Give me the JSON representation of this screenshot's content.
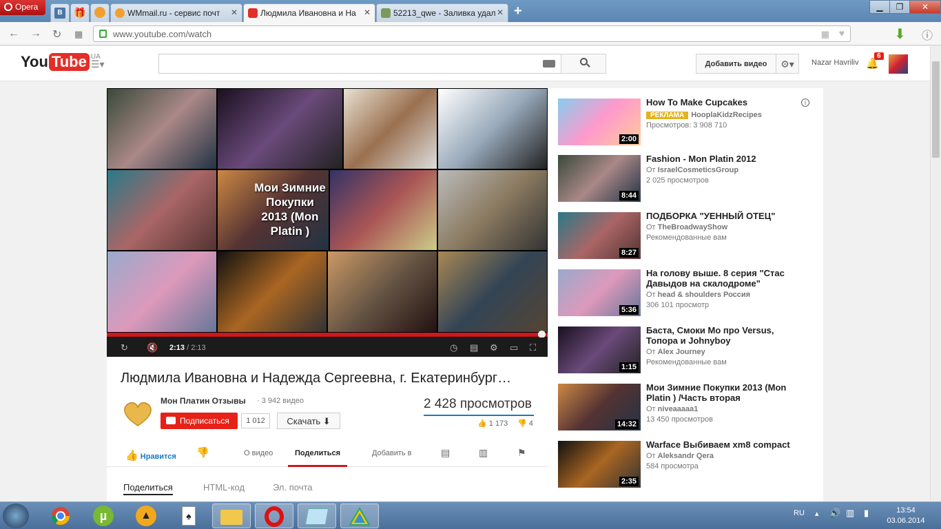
{
  "browser": {
    "app_name": "Opera",
    "tabs": [
      {
        "label": "WMmail.ru - сервис почт"
      },
      {
        "label": "Людмила Ивановна и На"
      },
      {
        "label": "52213_qwe - Заливка удал"
      }
    ],
    "url": "www.youtube.com/watch"
  },
  "youtube": {
    "logo_text": "You",
    "logo_tube": "Tube",
    "region": "UA",
    "upload_label": "Добавить видео",
    "user_name": "Nazar Havriliv",
    "notifications": "6"
  },
  "player": {
    "mosaic_text": "Мои Зимние Покупки 2013 (Mon Platin )",
    "time_current": "2:13",
    "time_total": "/ 2:13",
    "progress": 1.0
  },
  "video": {
    "title": "Людмила Ивановна и Надежда Сергеевна, г. Екатеринбург…",
    "channel": "Мон Платин Отзывы",
    "channel_videos": "· 3 942 видео",
    "subscribe_label": "Подписаться",
    "subscribers": "1 012",
    "download_label": "Скачать",
    "views": "2 428 просмотров",
    "likes": "1 173",
    "dislikes": "4"
  },
  "action_tabs": {
    "like": "Нравится",
    "about": "О видео",
    "share": "Поделиться",
    "add_to": "Добавить в"
  },
  "share_tabs": [
    "Поделиться",
    "HTML-код",
    "Эл. почта"
  ],
  "recommendations": [
    {
      "title": "How To Make Cupcakes",
      "ad": "РЕКЛАМА",
      "channel": "HooplaKidzRecipes",
      "meta": "Просмотров: 3 908 710",
      "duration": "2:00"
    },
    {
      "title": "Fashion - Mon Platin 2012",
      "from": "От",
      "channel": "IsraelCosmeticsGroup",
      "meta": "2 025 просмотров",
      "duration": "8:44"
    },
    {
      "title": "ПОДБОРКА \"УЕННЫЙ ОТЕЦ\"",
      "from": "От",
      "channel": "TheBroadwayShow",
      "meta": "Рекомендованные вам",
      "duration": "8:27"
    },
    {
      "title": "На голову выше. 8 серия \"Стас Давыдов на скалодроме\"",
      "from": "От",
      "channel": "head & shoulders Россия",
      "meta": "306 101 просмотр",
      "duration": "5:36"
    },
    {
      "title": "Баста, Смоки Мо про Versus, Топора и Johnyboy",
      "from": "От",
      "channel": "Alex Journey",
      "meta": "Рекомендованные вам",
      "duration": "1:15"
    },
    {
      "title": "Мои Зимние Покупки 2013 (Mon Platin ) /Часть вторая",
      "from": "От",
      "channel": "niveaaaaa1",
      "meta": "13 450 просмотров",
      "duration": "14:32"
    },
    {
      "title": "Warface Выбиваем xm8 compact",
      "from": "От",
      "channel": "Aleksandr Qera",
      "meta": "584 просмотра",
      "duration": "2:35"
    }
  ],
  "taskbar": {
    "lang": "RU",
    "time": "13:54",
    "date": "03.06.2014"
  }
}
